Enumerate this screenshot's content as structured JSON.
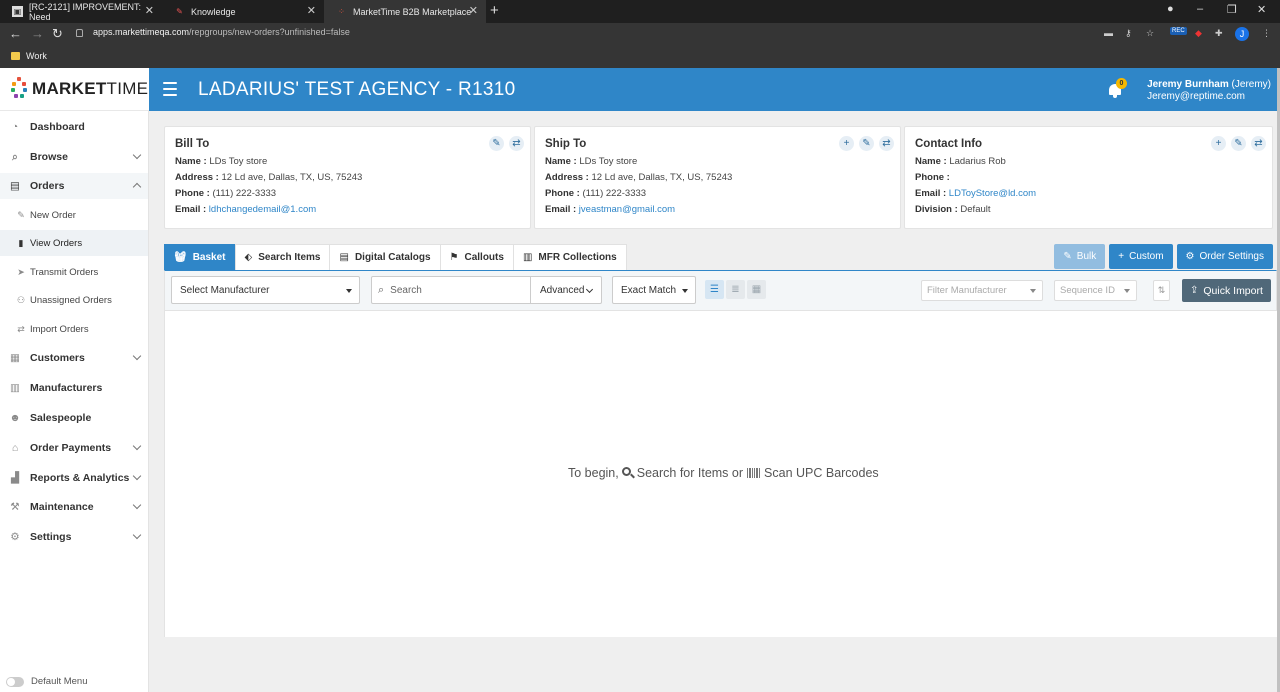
{
  "browser": {
    "tabs": [
      {
        "label": "[RC-2121] IMPROVEMENT: Need",
        "active": false
      },
      {
        "label": "Knowledge",
        "active": false
      },
      {
        "label": "MarketTime B2B Marketplace",
        "active": true
      }
    ],
    "url_host": "apps.markettimeqa.com",
    "url_path": "/repgroups/new-orders?unfinished=false",
    "profile_initial": "J",
    "rec_badge": "REC",
    "bookmark": "Work"
  },
  "logo": {
    "bold": "MARKET",
    "light": "TIME"
  },
  "header": {
    "agency": "LADARIUS' TEST AGENCY - R1310",
    "notifications": "0",
    "user_name": "Jeremy Burnham",
    "user_nick": "(Jeremy)",
    "user_email": "Jeremy@reptime.com"
  },
  "sidebar": {
    "items": [
      {
        "label": "Dashboard",
        "icon": "dashboard-icon"
      },
      {
        "label": "Browse",
        "icon": "search-icon"
      },
      {
        "label": "Orders",
        "icon": "orders-icon"
      },
      {
        "label": "Customers",
        "icon": "customers-icon"
      },
      {
        "label": "Manufacturers",
        "icon": "building-icon"
      },
      {
        "label": "Salespeople",
        "icon": "people-icon"
      },
      {
        "label": "Order Payments",
        "icon": "bank-icon"
      },
      {
        "label": "Reports & Analytics",
        "icon": "chart-icon"
      },
      {
        "label": "Maintenance",
        "icon": "wrench-icon"
      },
      {
        "label": "Settings",
        "icon": "gears-icon"
      }
    ],
    "orders_sub": [
      {
        "label": "New Order",
        "icon": "edit-icon"
      },
      {
        "label": "View Orders",
        "icon": "file-icon"
      },
      {
        "label": "Transmit Orders",
        "icon": "send-icon"
      },
      {
        "label": "Unassigned Orders",
        "icon": "user-plus-icon"
      },
      {
        "label": "Import Orders",
        "icon": "exchange-icon"
      }
    ],
    "default_menu": "Default Menu"
  },
  "bill_to": {
    "title": "Bill To",
    "name_label": "Name :",
    "name": "LDs Toy store",
    "address_label": "Address :",
    "address": "12 Ld ave, Dallas, TX, US, 75243",
    "phone_label": "Phone :",
    "phone": "(111) 222-3333",
    "email_label": "Email :",
    "email": "ldhchangedemail@1.com"
  },
  "ship_to": {
    "title": "Ship To",
    "name_label": "Name :",
    "name": "LDs Toy store",
    "address_label": "Address :",
    "address": "12 Ld ave, Dallas, TX, US, 75243",
    "phone_label": "Phone :",
    "phone": "(111) 222-3333",
    "email_label": "Email :",
    "email": "jveastman@gmail.com"
  },
  "contact": {
    "title": "Contact Info",
    "name_label": "Name :",
    "name": "Ladarius Rob",
    "phone_label": "Phone :",
    "phone": "",
    "email_label": "Email :",
    "email": "LDToyStore@ld.com",
    "division_label": "Division :",
    "division": "Default"
  },
  "tabs": [
    {
      "label": "Basket",
      "icon": "basket-icon",
      "active": true
    },
    {
      "label": "Search Items",
      "icon": "tag-icon",
      "active": false
    },
    {
      "label": "Digital Catalogs",
      "icon": "book-icon",
      "active": false
    },
    {
      "label": "Callouts",
      "icon": "flag-icon",
      "active": false
    },
    {
      "label": "MFR Collections",
      "icon": "building-icon",
      "active": false
    }
  ],
  "actions": {
    "bulk": "Bulk",
    "custom": "Custom",
    "order_settings": "Order Settings"
  },
  "toolbar": {
    "manufacturer_select": "Select Manufacturer",
    "search_placeholder": "Search",
    "advanced": "Advanced",
    "match_mode": "Exact Match",
    "filter_manufacturer": "Filter Manufacturer",
    "sequence_id": "Sequence ID",
    "quick_import": "Quick Import"
  },
  "empty": {
    "prefix": "To begin,",
    "search_text": "Search for Items or",
    "scan_text": "Scan UPC Barcodes"
  },
  "colors": {
    "brand_blue": "#2f86c8",
    "quick_import": "#506879"
  }
}
